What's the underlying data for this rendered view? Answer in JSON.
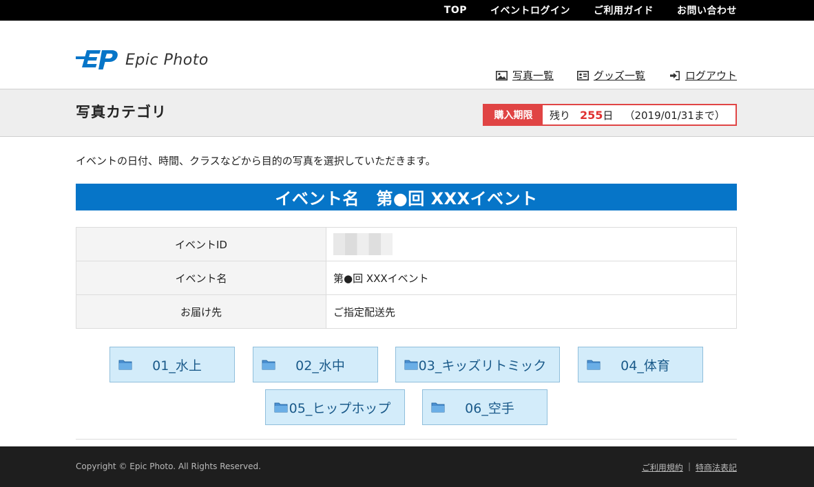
{
  "topnav": {
    "items": [
      "TOP",
      "イベントログイン",
      "ご利用ガイド",
      "お問い合わせ"
    ]
  },
  "header": {
    "logo_text": "Epic Photo",
    "brand_color": "#0675c8",
    "subnav": [
      {
        "label": "写真一覧",
        "icon": "image-icon"
      },
      {
        "label": "グッズ一覧",
        "icon": "id-card-icon"
      },
      {
        "label": "ログアウト",
        "icon": "logout-icon"
      }
    ]
  },
  "title_band": {
    "page_title": "写真カテゴリ",
    "deadline_badge": "購入期限",
    "deadline_prefix": "残り",
    "deadline_days": "255",
    "deadline_unit": "日",
    "deadline_date": "（2019/01/31まで）",
    "accent": "#e04444"
  },
  "intro": "イベントの日付、時間、クラスなどから目的の写真を選択していただきます。",
  "event_banner": "イベント名　第●回 XXXイベント",
  "info_table": [
    {
      "label": "イベントID",
      "value": ""
    },
    {
      "label": "イベント名",
      "value": "第●回 XXXイベント"
    },
    {
      "label": "お届け先",
      "value": "ご指定配送先"
    }
  ],
  "categories": [
    "01_水上",
    "02_水中",
    "03_キッズリトミック",
    "04_体育",
    "05_ヒップホップ",
    "06_空手"
  ],
  "footer": {
    "copyright": "Copyright © Epic Photo. All Rights Reserved.",
    "links": [
      "ご利用規約",
      "特商法表記"
    ]
  }
}
